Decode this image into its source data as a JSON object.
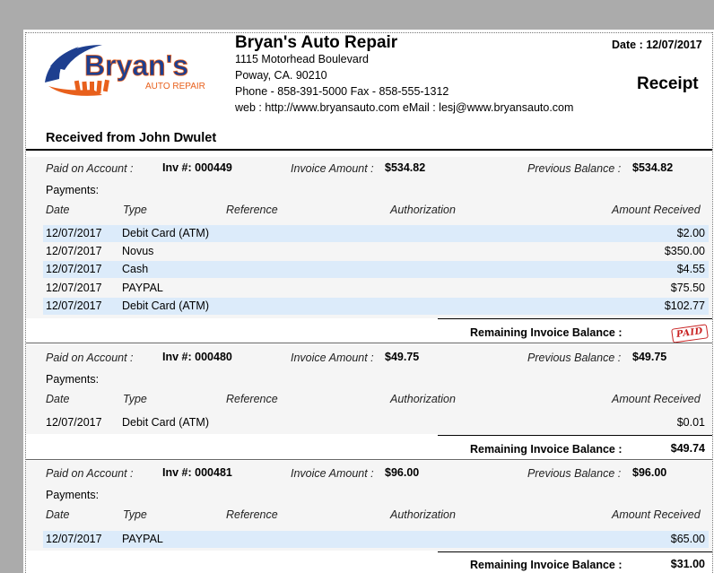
{
  "company": {
    "name": "Bryan's Auto Repair",
    "address1": "1115 Motorhead Boulevard",
    "address2": "Poway, CA. 90210",
    "phone_line": "Phone - 858-391-5000   Fax - 858-555-1312",
    "web_line": "web : http://www.bryansauto.com  eMail : lesj@www.bryansauto.com",
    "logo_text": "Bryan's",
    "logo_sub": "AUTO REPAIR"
  },
  "receipt": {
    "date_label": "Date : 12/07/2017",
    "title": "Receipt",
    "received_from": "Received from  John Dwulet"
  },
  "labels": {
    "paid_on_account": "Paid on Account :",
    "inv_prefix": "Inv #:",
    "invoice_amount": "Invoice Amount :",
    "previous_balance": "Previous Balance :",
    "payments": "Payments:",
    "col_date": "Date",
    "col_type": "Type",
    "col_reference": "Reference",
    "col_authorization": "Authorization",
    "col_amount": "Amount Received",
    "remaining": "Remaining Invoice Balance :",
    "paid_stamp": "PAID"
  },
  "invoices": [
    {
      "inv": "000449",
      "invoice_amount": "$534.82",
      "previous_balance": "$534.82",
      "payments": [
        {
          "date": "12/07/2017",
          "type": "Debit Card (ATM)",
          "amount": "$2.00"
        },
        {
          "date": "12/07/2017",
          "type": "Novus",
          "amount": "$350.00"
        },
        {
          "date": "12/07/2017",
          "type": "Cash",
          "amount": "$4.55"
        },
        {
          "date": "12/07/2017",
          "type": "PAYPAL",
          "amount": "$75.50"
        },
        {
          "date": "12/07/2017",
          "type": "Debit Card (ATM)",
          "amount": "$102.77"
        }
      ],
      "remaining": ""
    },
    {
      "inv": "000480",
      "invoice_amount": "$49.75",
      "previous_balance": "$49.75",
      "payments": [
        {
          "date": "12/07/2017",
          "type": "Debit Card (ATM)",
          "amount": "$0.01"
        }
      ],
      "remaining": "$49.74"
    },
    {
      "inv": "000481",
      "invoice_amount": "$96.00",
      "previous_balance": "$96.00",
      "payments": [
        {
          "date": "12/07/2017",
          "type": "PAYPAL",
          "amount": "$65.00"
        }
      ],
      "remaining": "$31.00"
    }
  ],
  "colors": {
    "band_blue": "#dcebfa",
    "section_bg": "#f5f5f5",
    "logo_blue": "#1e3f8f",
    "logo_orange": "#e8601c",
    "stamp_red": "#c82020"
  }
}
